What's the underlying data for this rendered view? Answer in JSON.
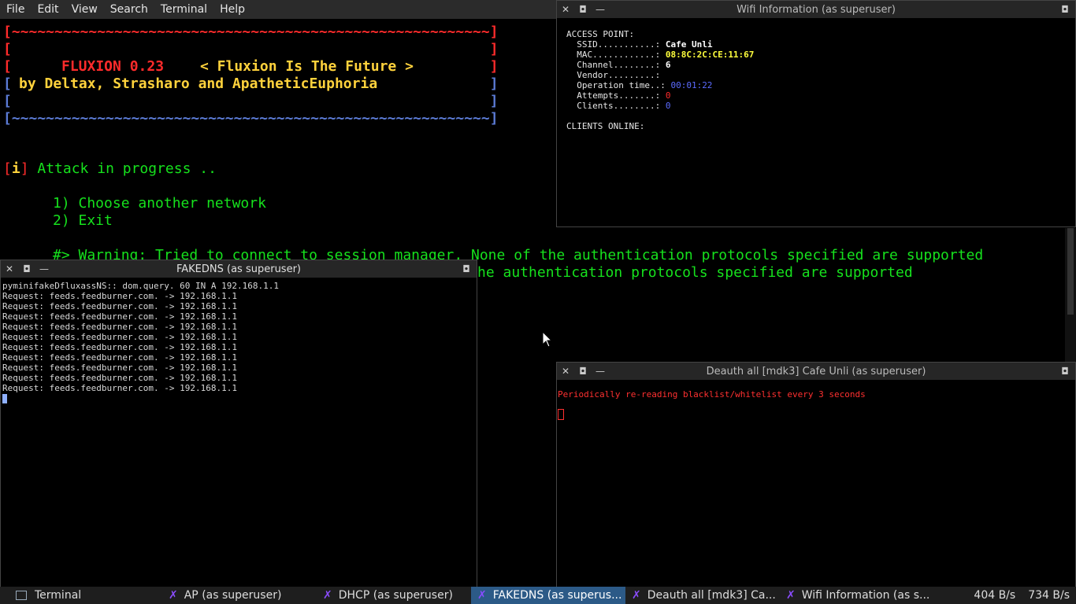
{
  "menubar": {
    "items": [
      "File",
      "Edit",
      "View",
      "Search",
      "Terminal",
      "Help"
    ]
  },
  "banner": {
    "top_border": "[~~~~~~~~~~~~~~~~~~~~~~~~~~~~~~~~~~~~~~~~~~~~~~~~~~~~~~~~]",
    "blank": "[                                                        ]",
    "title": "FLUXION 0.23",
    "motto": "< Fluxion Is The Future >",
    "authors": "by Deltax, Strasharo and ApatheticEuphoria",
    "bottom_border": "[~~~~~~~~~~~~~~~~~~~~~~~~~~~~~~~~~~~~~~~~~~~~~~~~~~~~~~~~]"
  },
  "status": {
    "prefix": "i",
    "text": "Attack in progress .."
  },
  "menu_options": [
    "1) Choose another network",
    "2) Exit"
  ],
  "warnings": [
    "#> Warning: Tried to connect to session manager, None of the authentication protocols specified are supported",
    "he authentication protocols specified are supported"
  ],
  "wifi_window": {
    "title": "Wifi Information (as superuser)",
    "heading": "ACCESS POINT:",
    "ssid_label": "  SSID...........: ",
    "ssid": "Cafe Unli",
    "mac_label": "  MAC............: ",
    "mac": "08:8C:2C:CE:11:67",
    "channel_label": "  Channel........: ",
    "channel": "6",
    "vendor_label": "  Vendor.........: ",
    "optime_label": "  Operation time..: ",
    "optime": "00:01:22",
    "attempts_label": "  Attempts.......: ",
    "attempts": "0",
    "clients_label": "  Clients........: ",
    "clients": "0",
    "clients_online": "CLIENTS ONLINE:"
  },
  "fakedns_window": {
    "title": "FAKEDNS (as superuser)",
    "first_line": "pyminifakeDfluxassNS:: dom.query. 60 IN A 192.168.1.1",
    "requests": [
      "Request: feeds.feedburner.com. -> 192.168.1.1",
      "Request: feeds.feedburner.com. -> 192.168.1.1",
      "Request: feeds.feedburner.com. -> 192.168.1.1",
      "Request: feeds.feedburner.com. -> 192.168.1.1",
      "Request: feeds.feedburner.com. -> 192.168.1.1",
      "Request: feeds.feedburner.com. -> 192.168.1.1",
      "Request: feeds.feedburner.com. -> 192.168.1.1",
      "Request: feeds.feedburner.com. -> 192.168.1.1",
      "Request: feeds.feedburner.com. -> 192.168.1.1",
      "Request: feeds.feedburner.com. -> 192.168.1.1"
    ]
  },
  "deauth_window": {
    "title": "Deauth all [mdk3]  Cafe Unli (as superuser)",
    "message": "Periodically re-reading blacklist/whitelist every 3 seconds"
  },
  "taskbar": {
    "tasks": [
      {
        "label": "Terminal",
        "icon": "terminal-icon"
      },
      {
        "label": "AP (as superuser)",
        "icon": "x-app-icon"
      },
      {
        "label": "DHCP (as superuser)",
        "icon": "x-app-icon"
      },
      {
        "label": "FAKEDNS (as superus...",
        "icon": "x-app-icon",
        "active": true
      },
      {
        "label": "Deauth all [mdk3]  Ca...",
        "icon": "x-app-icon"
      },
      {
        "label": "Wifi Information (as s...",
        "icon": "x-app-icon"
      }
    ],
    "net_down": "404 B/s",
    "net_up": "734 B/s"
  },
  "colors": {
    "green": "#16e11d",
    "yellow": "#ffd23c",
    "red": "#ff2b2b",
    "blue": "#5b7bd5"
  }
}
